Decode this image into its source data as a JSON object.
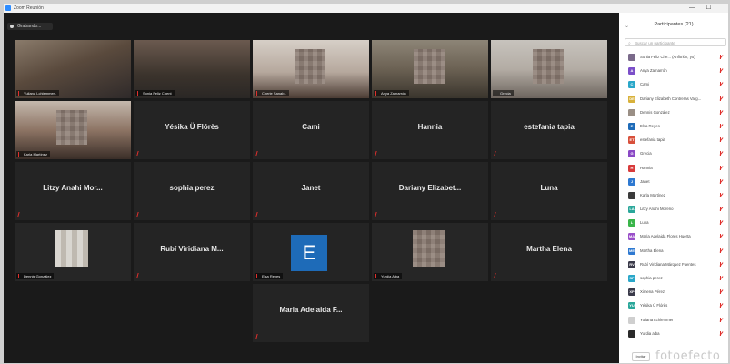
{
  "window": {
    "title": "Zoom Reunión",
    "minimize": "—",
    "maximize": "☐"
  },
  "toolbar": {
    "recording_label": "Grabando..."
  },
  "gallery": {
    "tiles": [
      {
        "label": "Yuliana Lchlemmer..",
        "type": "video"
      },
      {
        "label": "Sonia Feliz Chent",
        "type": "video",
        "active": true
      },
      {
        "label": "Cherie Sanab..",
        "type": "video"
      },
      {
        "label": "Anya Zamarrón",
        "type": "video"
      },
      {
        "label": "Grecia",
        "type": "video"
      },
      {
        "label": "Karla Martínez",
        "type": "video"
      },
      {
        "name": "Yésika Ü Flórès",
        "type": "name"
      },
      {
        "name": "Cami",
        "type": "name"
      },
      {
        "name": "Hannia",
        "type": "name"
      },
      {
        "name": "estefania tapia",
        "type": "name"
      },
      {
        "name": "Litzy Anahi Mor...",
        "type": "name"
      },
      {
        "name": "sophia perez",
        "type": "name"
      },
      {
        "name": "Janet",
        "type": "name"
      },
      {
        "name": "Dariany Elizabet...",
        "type": "name"
      },
      {
        "name": "Luna",
        "type": "name"
      },
      {
        "label": "Dennis González",
        "type": "video"
      },
      {
        "name": "Rubí Viridiana M...",
        "type": "name"
      },
      {
        "label": "Elsa Reyes",
        "avatar_letter": "E",
        "type": "avatar"
      },
      {
        "label": "Yurdia Alba",
        "type": "video"
      },
      {
        "name": "Martha Elena",
        "type": "name"
      },
      {
        "name": "Maria Adelaida F...",
        "type": "name"
      }
    ]
  },
  "panel": {
    "title": "Participantes (21)",
    "collapse_icon": "⌄",
    "search_placeholder": "Buscar un participante",
    "footer_button": "Invitar",
    "participants": [
      {
        "name": "Sonia Feliz Che... (Anfitrión, yo)",
        "initials": "",
        "color": "#7a6a8a"
      },
      {
        "name": "Anya Zamarrón",
        "initials": "A",
        "color": "#7b4fc9"
      },
      {
        "name": "Cami",
        "initials": "C",
        "color": "#2aa7c9"
      },
      {
        "name": "Dariany Elizabeth Contreras Varg...",
        "initials": "DE",
        "color": "#d8b13a"
      },
      {
        "name": "Dennis González",
        "initials": "",
        "color": "#9a8f85"
      },
      {
        "name": "Elsa Reyes",
        "initials": "E",
        "color": "#1e6bb8"
      },
      {
        "name": "estefania tapia",
        "initials": "ET",
        "color": "#d8503b"
      },
      {
        "name": "Grecia",
        "initials": "G",
        "color": "#8a49c5"
      },
      {
        "name": "Hannia",
        "initials": "H",
        "color": "#d83b3b"
      },
      {
        "name": "Janet",
        "initials": "J",
        "color": "#2e79d1"
      },
      {
        "name": "Karla Martínez",
        "initials": "",
        "color": "#3b3b3b"
      },
      {
        "name": "Litzy Anahi Moreno",
        "initials": "LA",
        "color": "#2aa79a"
      },
      {
        "name": "Luna",
        "initials": "L",
        "color": "#3ab54a"
      },
      {
        "name": "Maria Adelaida Flores Huerta",
        "initials": "MA",
        "color": "#9a4fc9"
      },
      {
        "name": "Martha Elena",
        "initials": "ME",
        "color": "#2e79d1"
      },
      {
        "name": "Rubí Viridiana Márquez Fuentes",
        "initials": "RV",
        "color": "#3a3a4a"
      },
      {
        "name": "sophia perez",
        "initials": "SP",
        "color": "#2aa7c9"
      },
      {
        "name": "Ximena Pérez",
        "initials": "XP",
        "color": "#3a3a4a"
      },
      {
        "name": "Yésika Ü Flórès",
        "initials": "YU",
        "color": "#2aa79a"
      },
      {
        "name": "Yuliana Lchlemmer",
        "initials": "",
        "color": "#cfcfcf"
      },
      {
        "name": "Yurdia alba",
        "initials": "",
        "color": "#2a2a2a"
      }
    ]
  },
  "watermark": "fotoefecto"
}
